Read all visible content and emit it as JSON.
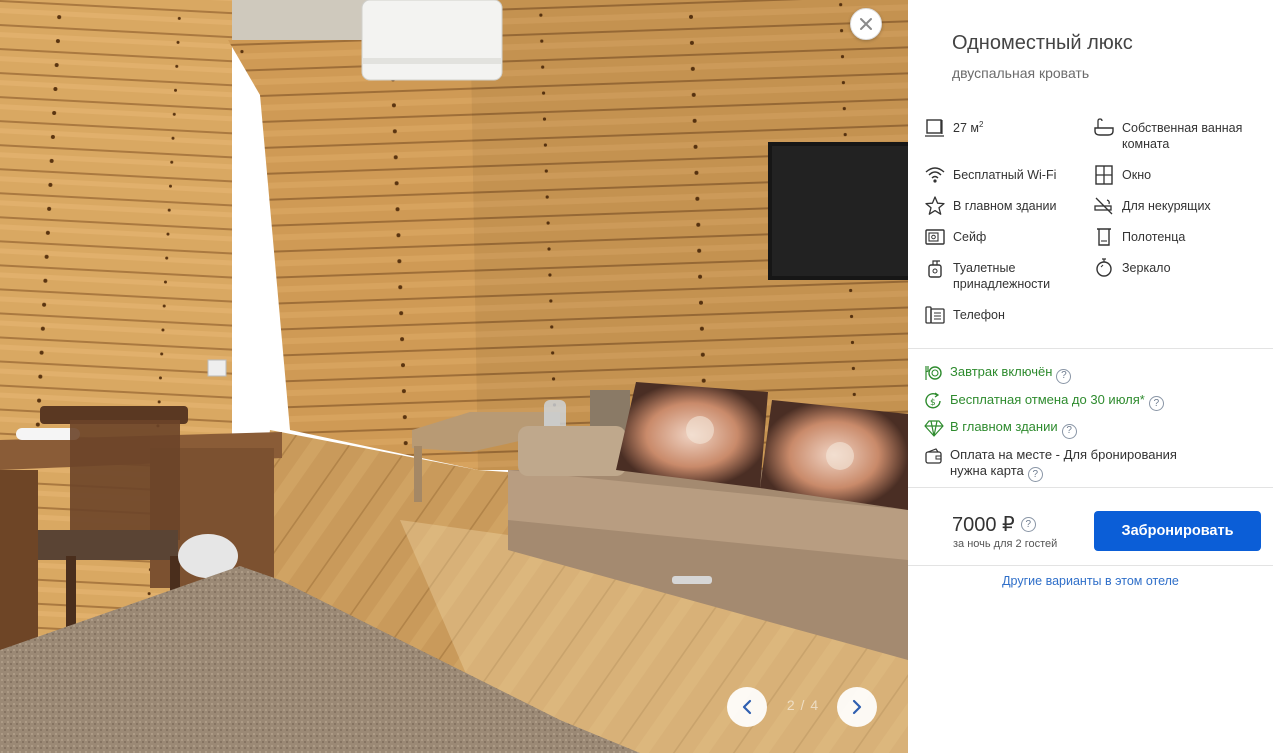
{
  "photo": {
    "close_label": "×",
    "prev_icon": "chevron-left-icon",
    "next_icon": "chevron-right-icon",
    "counter": "2 / 4"
  },
  "room": {
    "title": "Одноместный люкс",
    "subtitle": "двуспальная кровать"
  },
  "amenities": [
    {
      "icon": "area-icon",
      "label": "27 м",
      "sup": "2"
    },
    {
      "icon": "bathtub-icon",
      "label": "Собственная ванная комната"
    },
    {
      "icon": "wifi-icon",
      "label": "Бесплатный Wi-Fi"
    },
    {
      "icon": "window-icon",
      "label": "Окно"
    },
    {
      "icon": "star-icon",
      "label": "В главном здании"
    },
    {
      "icon": "no-smoking-icon",
      "label": "Для некурящих"
    },
    {
      "icon": "safe-icon",
      "label": "Сейф"
    },
    {
      "icon": "towel-icon",
      "label": "Полотенца"
    },
    {
      "icon": "toiletries-icon",
      "label": "Туалетные принадлежности"
    },
    {
      "icon": "mirror-icon",
      "label": "Зеркало"
    },
    {
      "icon": "phone-icon",
      "label": "Телефон"
    }
  ],
  "perks": [
    {
      "icon": "breakfast-icon",
      "label": "Завтрак включён",
      "style": "green"
    },
    {
      "icon": "refund-icon",
      "label": "Бесплатная отмена до 30 июля*",
      "style": "green"
    },
    {
      "icon": "diamond-icon",
      "label": "В главном здании",
      "style": "green"
    },
    {
      "icon": "wallet-icon",
      "label": "Оплата на месте - Для бронирования нужна карта",
      "style": "plain"
    }
  ],
  "booking": {
    "price": "7000 ₽",
    "price_note": "за ночь для 2 гостей",
    "book_label": "Забронировать",
    "other_link": "Другие варианты в этом отеле",
    "help_glyph": "?"
  },
  "colors": {
    "accent": "#0b5ed7",
    "perk_green": "#2e8b2e",
    "link": "#2f6fc9"
  }
}
